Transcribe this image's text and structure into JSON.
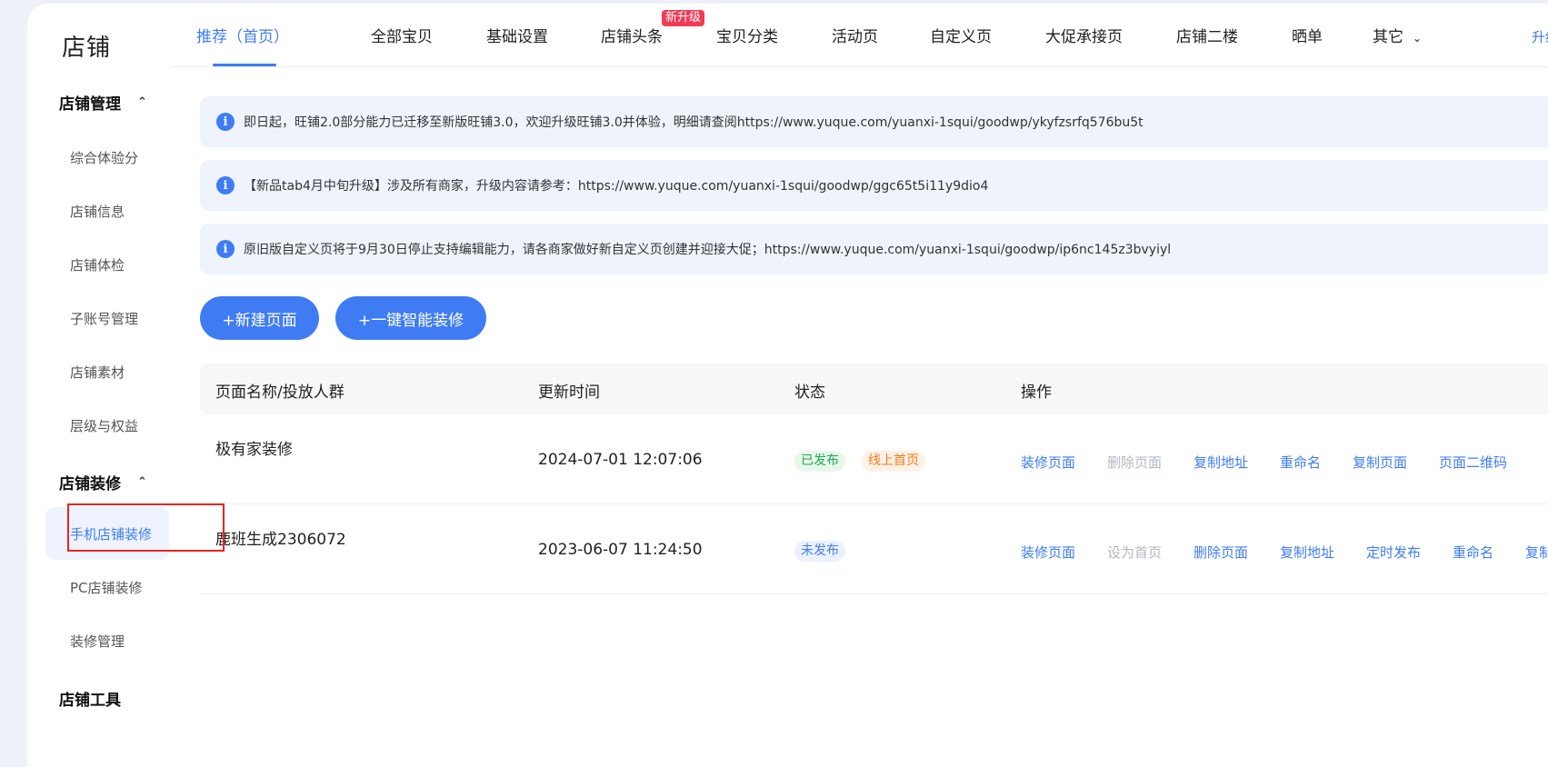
{
  "sidebar": {
    "brand": "店铺",
    "groups": [
      {
        "label": "店铺管理",
        "items": [
          "综合体验分",
          "店铺信息",
          "店铺体检",
          "子账号管理",
          "店铺素材",
          "层级与权益"
        ]
      },
      {
        "label": "店铺装修",
        "items": [
          "手机店铺装修",
          "PC店铺装修",
          "装修管理"
        ]
      },
      {
        "label": "店铺工具"
      }
    ],
    "active_item": "手机店铺装修"
  },
  "topnav": {
    "tabs": [
      "推荐（首页）",
      "全部宝贝",
      "基础设置",
      "店铺头条",
      "宝贝分类",
      "活动页",
      "自定义页",
      "大促承接页",
      "店铺二楼",
      "晒单",
      "其它"
    ],
    "active_tab": "推荐（首页）",
    "badge": "新升级",
    "upgrade_link": "升级新"
  },
  "notices": [
    "即日起，旺铺2.0部分能力已迁移至新版旺铺3.0，欢迎升级旺铺3.0并体验，明细请查阅https://www.yuque.com/yuanxi-1squi/goodwp/ykyfzsrfq576bu5t",
    "【新品tab4月中旬升级】涉及所有商家，升级内容请参考：https://www.yuque.com/yuanxi-1squi/goodwp/ggc65t5i11y9dio4",
    "原旧版自定义页将于9月30日停止支持编辑能力，请各商家做好新自定义页创建并迎接大促；https://www.yuque.com/yuanxi-1squi/goodwp/ip6nc145z3bvyiyl"
  ],
  "actions": {
    "new_page": "+新建页面",
    "smart_decorate": "+一键智能装修"
  },
  "table": {
    "headers": [
      "页面名称/投放人群",
      "更新时间",
      "状态",
      "操作"
    ],
    "rows": [
      {
        "name": "极有家装修",
        "time": "2024-07-01 12:07:06",
        "tags": [
          "已发布",
          "线上首页"
        ],
        "ops": [
          "装修页面",
          "删除页面",
          "复制地址",
          "重命名",
          "复制页面",
          "页面二维码"
        ]
      },
      {
        "name": "鹿班生成2306072",
        "time": "2023-06-07 11:24:50",
        "tags": [
          "未发布"
        ],
        "ops": [
          "装修页面",
          "设为首页",
          "删除页面",
          "复制地址",
          "定时发布",
          "重命名",
          "复制"
        ]
      }
    ]
  },
  "colors": {
    "accent": "#3f7cf3",
    "badge": "#f23a57",
    "highlight": "#e8261e"
  }
}
